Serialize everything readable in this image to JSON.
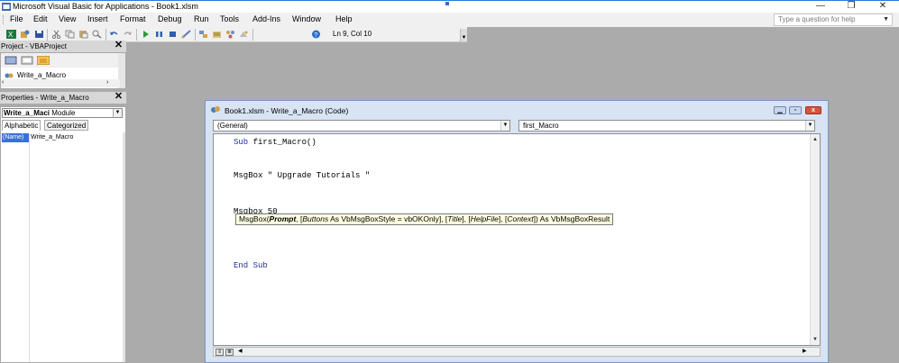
{
  "window": {
    "title": "Microsoft Visual Basic for Applications - Book1.xlsm",
    "controls": [
      "—",
      "❐",
      "✕"
    ]
  },
  "menu": {
    "items": [
      "File",
      "Edit",
      "View",
      "Insert",
      "Format",
      "Debug",
      "Run",
      "Tools",
      "Add-Ins",
      "Window",
      "Help"
    ],
    "help_placeholder": "Type a question for help"
  },
  "toolbar": {
    "icons": [
      "excel-icon",
      "insert-module-icon",
      "save-icon",
      "cut-icon",
      "copy-icon",
      "paste-icon",
      "find-icon",
      "undo-icon",
      "redo-icon",
      "run-icon",
      "break-icon",
      "reset-icon",
      "design-mode-icon",
      "project-explorer-icon",
      "properties-icon",
      "object-browser-icon",
      "toolbox-icon",
      "help-icon"
    ],
    "position": "Ln 9, Col 10"
  },
  "project_pane": {
    "title": "Project - VBAProject",
    "item": "Write_a_Macro"
  },
  "properties_pane": {
    "title": "Properties - Write_a_Macro",
    "object_name": "Write_a_Maci",
    "object_type": "Module",
    "tabs": [
      "Alphabetic",
      "Categorized"
    ],
    "property_name": "(Name)",
    "property_value": "Write_a_Macro"
  },
  "code_window": {
    "title": "Book1.xlsm - Write_a_Macro (Code)",
    "object_dropdown": "(General)",
    "procedure_dropdown": "first_Macro",
    "lines": {
      "sub_kw": "Sub",
      "sub_name": " first_Macro()",
      "msgbox1": "MsgBox \" Upgrade Tutorials \"",
      "msgbox2": "Msgbox 50",
      "end_sub": "End Sub"
    },
    "tooltip": {
      "prefix": "MsgBox(",
      "prompt": "Prompt",
      "rest_a": ", [",
      "buttons": "Buttons",
      "rest_b": " As VbMsgBoxStyle = vbOKOnly], [",
      "title": "Title",
      "rest_c": "], [",
      "helpfile": "HelpFile",
      "rest_d": "], [",
      "context": "Context",
      "rest_e": "]) As VbMsgBoxResult"
    }
  },
  "colors": {
    "keyword": "#1f2f9c",
    "selection": "#3a6fd8",
    "tooltip_bg": "#ffffe1"
  }
}
